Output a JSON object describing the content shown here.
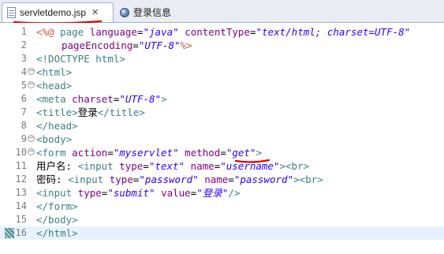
{
  "tabs": [
    {
      "label": "servletdemo.jsp",
      "icon": "jsp-file-icon",
      "active": true
    },
    {
      "label": "登录信息",
      "icon": "globe-icon",
      "active": false
    }
  ],
  "code_lines": [
    {
      "num": "1",
      "fold": false,
      "tokens": [
        [
          "dir",
          "<%@ "
        ],
        [
          "tag",
          "page "
        ],
        [
          "attr",
          "language"
        ],
        [
          "txt",
          "="
        ],
        [
          "val",
          "\"java\""
        ],
        [
          "txt",
          " "
        ],
        [
          "attr",
          "contentType"
        ],
        [
          "txt",
          "="
        ],
        [
          "val",
          "\"text/html; charset=UTF-8\""
        ]
      ]
    },
    {
      "num": "2",
      "fold": false,
      "indent": true,
      "tokens": [
        [
          "attr",
          "pageEncoding"
        ],
        [
          "txt",
          "="
        ],
        [
          "val",
          "\"UTF-8\""
        ],
        [
          "dir",
          "%>"
        ]
      ]
    },
    {
      "num": "3",
      "fold": false,
      "tokens": [
        [
          "doct",
          "<!DOCTYPE html>"
        ]
      ]
    },
    {
      "num": "4",
      "fold": true,
      "tokens": [
        [
          "tag",
          "<html>"
        ]
      ]
    },
    {
      "num": "5",
      "fold": true,
      "tokens": [
        [
          "tag",
          "<head>"
        ]
      ]
    },
    {
      "num": "6",
      "fold": false,
      "tokens": [
        [
          "tag",
          "<meta "
        ],
        [
          "attr",
          "charset"
        ],
        [
          "txt",
          "="
        ],
        [
          "val",
          "\"UTF-8\""
        ],
        [
          "tag",
          ">"
        ]
      ]
    },
    {
      "num": "7",
      "fold": false,
      "tokens": [
        [
          "tag",
          "<title>"
        ],
        [
          "txt",
          "登录"
        ],
        [
          "tag",
          "</title>"
        ]
      ]
    },
    {
      "num": "8",
      "fold": false,
      "tokens": [
        [
          "tag",
          "</head>"
        ]
      ]
    },
    {
      "num": "9",
      "fold": true,
      "tokens": [
        [
          "tag",
          "<body>"
        ]
      ]
    },
    {
      "num": "10",
      "fold": true,
      "tokens": [
        [
          "tag",
          "<form "
        ],
        [
          "attr",
          "action"
        ],
        [
          "txt",
          "="
        ],
        [
          "val",
          "\"myservlet\""
        ],
        [
          "txt",
          " "
        ],
        [
          "attr",
          "method"
        ],
        [
          "txt",
          "="
        ],
        [
          "val",
          "\"get\""
        ],
        [
          "tag",
          ">"
        ]
      ]
    },
    {
      "num": "11",
      "fold": false,
      "tokens": [
        [
          "txt",
          "用户名: "
        ],
        [
          "tag",
          "<input "
        ],
        [
          "attr",
          "type"
        ],
        [
          "txt",
          "="
        ],
        [
          "val",
          "\"text\""
        ],
        [
          "txt",
          " "
        ],
        [
          "attr",
          "name"
        ],
        [
          "txt",
          "="
        ],
        [
          "val",
          "\"username\""
        ],
        [
          "tag",
          "><br>"
        ]
      ]
    },
    {
      "num": "12",
      "fold": false,
      "tokens": [
        [
          "txt",
          "密码: "
        ],
        [
          "tag",
          "<input "
        ],
        [
          "attr",
          "type"
        ],
        [
          "txt",
          "="
        ],
        [
          "val",
          "\"password\""
        ],
        [
          "txt",
          " "
        ],
        [
          "attr",
          "name"
        ],
        [
          "txt",
          "="
        ],
        [
          "val",
          "\"password\""
        ],
        [
          "tag",
          "><br>"
        ]
      ]
    },
    {
      "num": "13",
      "fold": false,
      "tokens": [
        [
          "tag",
          "<input "
        ],
        [
          "attr",
          "type"
        ],
        [
          "txt",
          "="
        ],
        [
          "val",
          "\"submit\""
        ],
        [
          "txt",
          " "
        ],
        [
          "attr",
          "value"
        ],
        [
          "txt",
          "="
        ],
        [
          "val",
          "\"登录\""
        ],
        [
          "tag",
          "/>"
        ]
      ]
    },
    {
      "num": "14",
      "fold": false,
      "tokens": [
        [
          "tag",
          "</form>"
        ]
      ]
    },
    {
      "num": "15",
      "fold": false,
      "tokens": [
        [
          "tag",
          "</body>"
        ]
      ]
    },
    {
      "num": "16",
      "fold": false,
      "current": true,
      "bookmark": true,
      "tokens": [
        [
          "tag",
          "</html>"
        ]
      ]
    }
  ],
  "colors": {
    "tag": "#3f7f7f",
    "attribute": "#7f007f",
    "value": "#2a00ff",
    "annotation": "#e00000"
  }
}
